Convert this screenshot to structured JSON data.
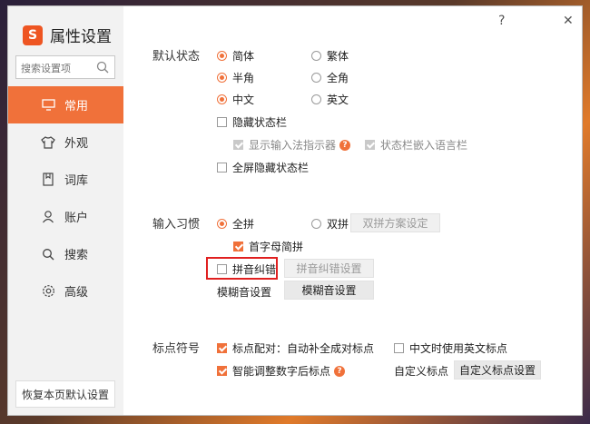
{
  "app": {
    "title": "属性设置",
    "logo_letter": "S",
    "help": "?",
    "close": "✕"
  },
  "sidebar": {
    "search_placeholder": "搜索设置项",
    "items": [
      {
        "label": "常用",
        "icon": "monitor-icon",
        "active": true
      },
      {
        "label": "外观",
        "icon": "shirt-icon"
      },
      {
        "label": "词库",
        "icon": "book-icon"
      },
      {
        "label": "账户",
        "icon": "user-icon"
      },
      {
        "label": "搜索",
        "icon": "search-icon"
      },
      {
        "label": "高级",
        "icon": "gear-icon"
      }
    ],
    "restore_label": "恢复本页默认设置"
  },
  "default_state": {
    "label": "默认状态",
    "simplified": "简体",
    "traditional": "繁体",
    "halfwidth": "半角",
    "fullwidth": "全角",
    "chinese": "中文",
    "english": "英文",
    "hide_status_bar": "隐藏状态栏",
    "show_indicator": "显示输入法指示器",
    "embed_language_bar": "状态栏嵌入语言栏",
    "fullscreen_hide": "全屏隐藏状态栏"
  },
  "input_habit": {
    "label": "输入习惯",
    "full_pinyin": "全拼",
    "double_pinyin": "双拼",
    "double_scheme_btn": "双拼方案设定",
    "initials_abbrev": "首字母简拼",
    "pinyin_correction": "拼音纠错",
    "pinyin_correction_btn": "拼音纠错设置",
    "fuzzy_label": "模糊音设置",
    "fuzzy_btn": "模糊音设置"
  },
  "punctuation": {
    "label": "标点符号",
    "auto_pair": "标点配对：自动补全成对标点",
    "english_punct": "中文时使用英文标点",
    "smart_number": "智能调整数字后标点",
    "custom_label": "自定义标点",
    "custom_btn": "自定义标点设置"
  },
  "colors": {
    "accent": "#f0713a",
    "highlight": "#e02020"
  }
}
